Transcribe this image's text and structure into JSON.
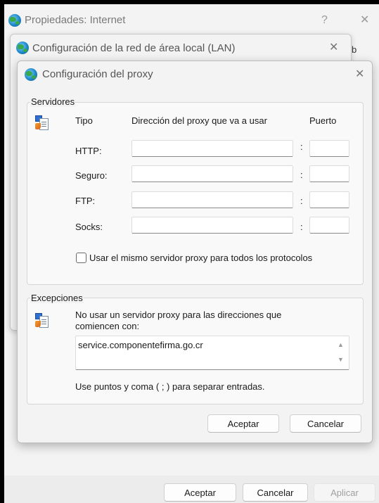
{
  "outer_window": {
    "title": "Propiedades: Internet",
    "help": "?",
    "close": "✕",
    "partial_tab": "b",
    "buttons": {
      "ok": "Aceptar",
      "cancel": "Cancelar",
      "apply": "Aplicar"
    }
  },
  "lan_window": {
    "title": "Configuración de la red de área local (LAN)",
    "close": "✕"
  },
  "proxy_window": {
    "title": "Configuración del proxy",
    "close": "✕",
    "servers": {
      "group_label": "Servidores",
      "col_type": "Tipo",
      "col_address": "Dirección del proxy que va a usar",
      "col_port": "Puerto",
      "rows": [
        {
          "label": "HTTP:",
          "address": "",
          "port": ""
        },
        {
          "label": "Seguro:",
          "address": "",
          "port": ""
        },
        {
          "label": "FTP:",
          "address": "",
          "port": ""
        },
        {
          "label": "Socks:",
          "address": "",
          "port": ""
        }
      ],
      "colon": ":",
      "same_server_label": "Usar el mismo servidor proxy para todos los protocolos",
      "same_server_checked": false
    },
    "exceptions": {
      "group_label": "Excepciones",
      "description_line1": "No usar un servidor proxy para las direcciones que",
      "description_line2": "comiencen con:",
      "value": "service.componentefirma.go.cr",
      "hint": "Use puntos y coma ( ; ) para separar entradas."
    },
    "buttons": {
      "ok": "Aceptar",
      "cancel": "Cancelar"
    }
  },
  "colors": {
    "window_bg": "#f3f3f3",
    "disabled_text": "#a0a0a0"
  }
}
